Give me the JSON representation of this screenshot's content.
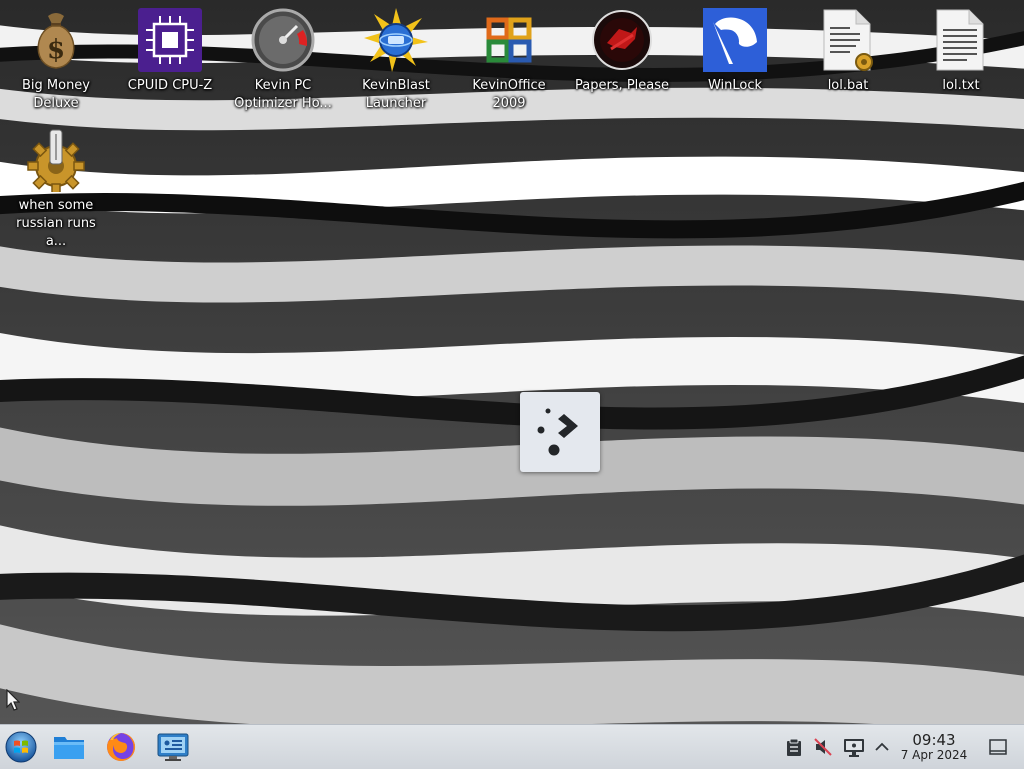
{
  "desktop": {
    "icons": [
      {
        "label": "Big Money Deluxe",
        "icon": "money-bag-icon"
      },
      {
        "label": "CPUID CPU-Z",
        "icon": "cpu-chip-icon"
      },
      {
        "label": "Kevin PC Optimizer Ho...",
        "icon": "speedometer-icon"
      },
      {
        "label": "KevinBlast Launcher",
        "icon": "globe-burst-icon"
      },
      {
        "label": "KevinOffice 2009",
        "icon": "office-logo-icon"
      },
      {
        "label": "Papers, Please",
        "icon": "papers-please-seal-icon"
      },
      {
        "label": "WinLock",
        "icon": "winlock-icon"
      },
      {
        "label": "lol.bat",
        "icon": "batch-file-icon"
      },
      {
        "label": "lol.txt",
        "icon": "text-file-icon"
      },
      {
        "label": "when some russian runs a...",
        "icon": "gear-script-icon"
      }
    ]
  },
  "launcher": {
    "icon": "app-launcher-icon"
  },
  "taskbar": {
    "buttons": [
      {
        "icon": "start-orb-icon"
      },
      {
        "icon": "file-manager-icon"
      },
      {
        "icon": "firefox-icon"
      },
      {
        "icon": "system-settings-icon"
      }
    ],
    "tray": [
      "clipboard-icon",
      "volume-muted-icon",
      "display-icon",
      "chevron-up-icon"
    ],
    "clock": {
      "time": "09:43",
      "date": "7 Apr 2024"
    },
    "show_desktop_icon": "show-desktop-icon"
  }
}
